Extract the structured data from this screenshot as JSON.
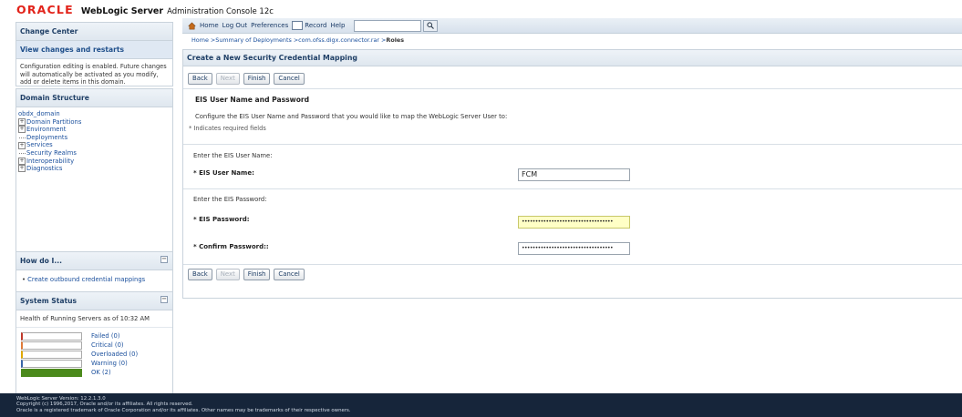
{
  "header": {
    "oracle_logo": "ORACLE",
    "product": "WebLogic Server",
    "console": "Administration Console 12c"
  },
  "toolbar": {
    "home": "Home",
    "logout": "Log Out",
    "preferences": "Preferences",
    "record": "Record",
    "help": "Help",
    "search_value": ""
  },
  "breadcrumb": {
    "prefix": "Home >Summary of Deployments >com.ofss.digx.connector.rar >",
    "current": "Roles"
  },
  "change_center": {
    "title": "Change Center",
    "link": "View changes and restarts",
    "text": "Configuration editing is enabled. Future changes will automatically be activated as you modify, add or delete items in this domain."
  },
  "domain_structure": {
    "title": "Domain Structure",
    "root": "obdx_domain",
    "items": [
      {
        "label": "Domain Partitions",
        "expandable": true
      },
      {
        "label": "Environment",
        "expandable": true
      },
      {
        "label": "Deployments",
        "expandable": false
      },
      {
        "label": "Services",
        "expandable": true
      },
      {
        "label": "Security Realms",
        "expandable": false
      },
      {
        "label": "Interoperability",
        "expandable": true
      },
      {
        "label": "Diagnostics",
        "expandable": true
      }
    ]
  },
  "how_do_i": {
    "title": "How do I...",
    "items": [
      "Create outbound credential mappings"
    ]
  },
  "system_status": {
    "title": "System Status",
    "subtitle": "Health of Running Servers as of  10:32 AM",
    "rows": [
      {
        "label": "Failed (0)",
        "color": "#c0392b",
        "fill": 0
      },
      {
        "label": "Critical (0)",
        "color": "#e07b39",
        "fill": 0
      },
      {
        "label": "Overloaded (0)",
        "color": "#e0a800",
        "fill": 0
      },
      {
        "label": "Warning (0)",
        "color": "#3a66a8",
        "fill": 0
      },
      {
        "label": "OK (2)",
        "color": "#4b8a1c",
        "fill": 1
      }
    ]
  },
  "form": {
    "title": "Create a New Security Credential Mapping",
    "buttons": {
      "back": "Back",
      "next": "Next",
      "finish": "Finish",
      "cancel": "Cancel"
    },
    "section_title": "EIS User Name and Password",
    "description": "Configure the EIS User Name and Password that you would like to map the WebLogic Server User to:",
    "required_note": "* Indicates required fields",
    "enter_user_label": "Enter the EIS User Name:",
    "user_label": "* EIS User Name:",
    "user_value": "FCM",
    "enter_pw_label": "Enter the EIS Password:",
    "pw_label": "* EIS Password:",
    "pw_value": "••••••••••••••••••••••••••••••••••",
    "confirm_label": "* Confirm Password::",
    "confirm_value": "••••••••••••••••••••••••••••••••••"
  },
  "footer": {
    "line1": "WebLogic Server Version: 12.2.1.3.0",
    "line2": "Copyright (c) 1996,2017, Oracle and/or its affiliates. All rights reserved.",
    "line3": "Oracle is a registered trademark of Oracle Corporation and/or its affiliates. Other names may be trademarks of their respective owners."
  }
}
